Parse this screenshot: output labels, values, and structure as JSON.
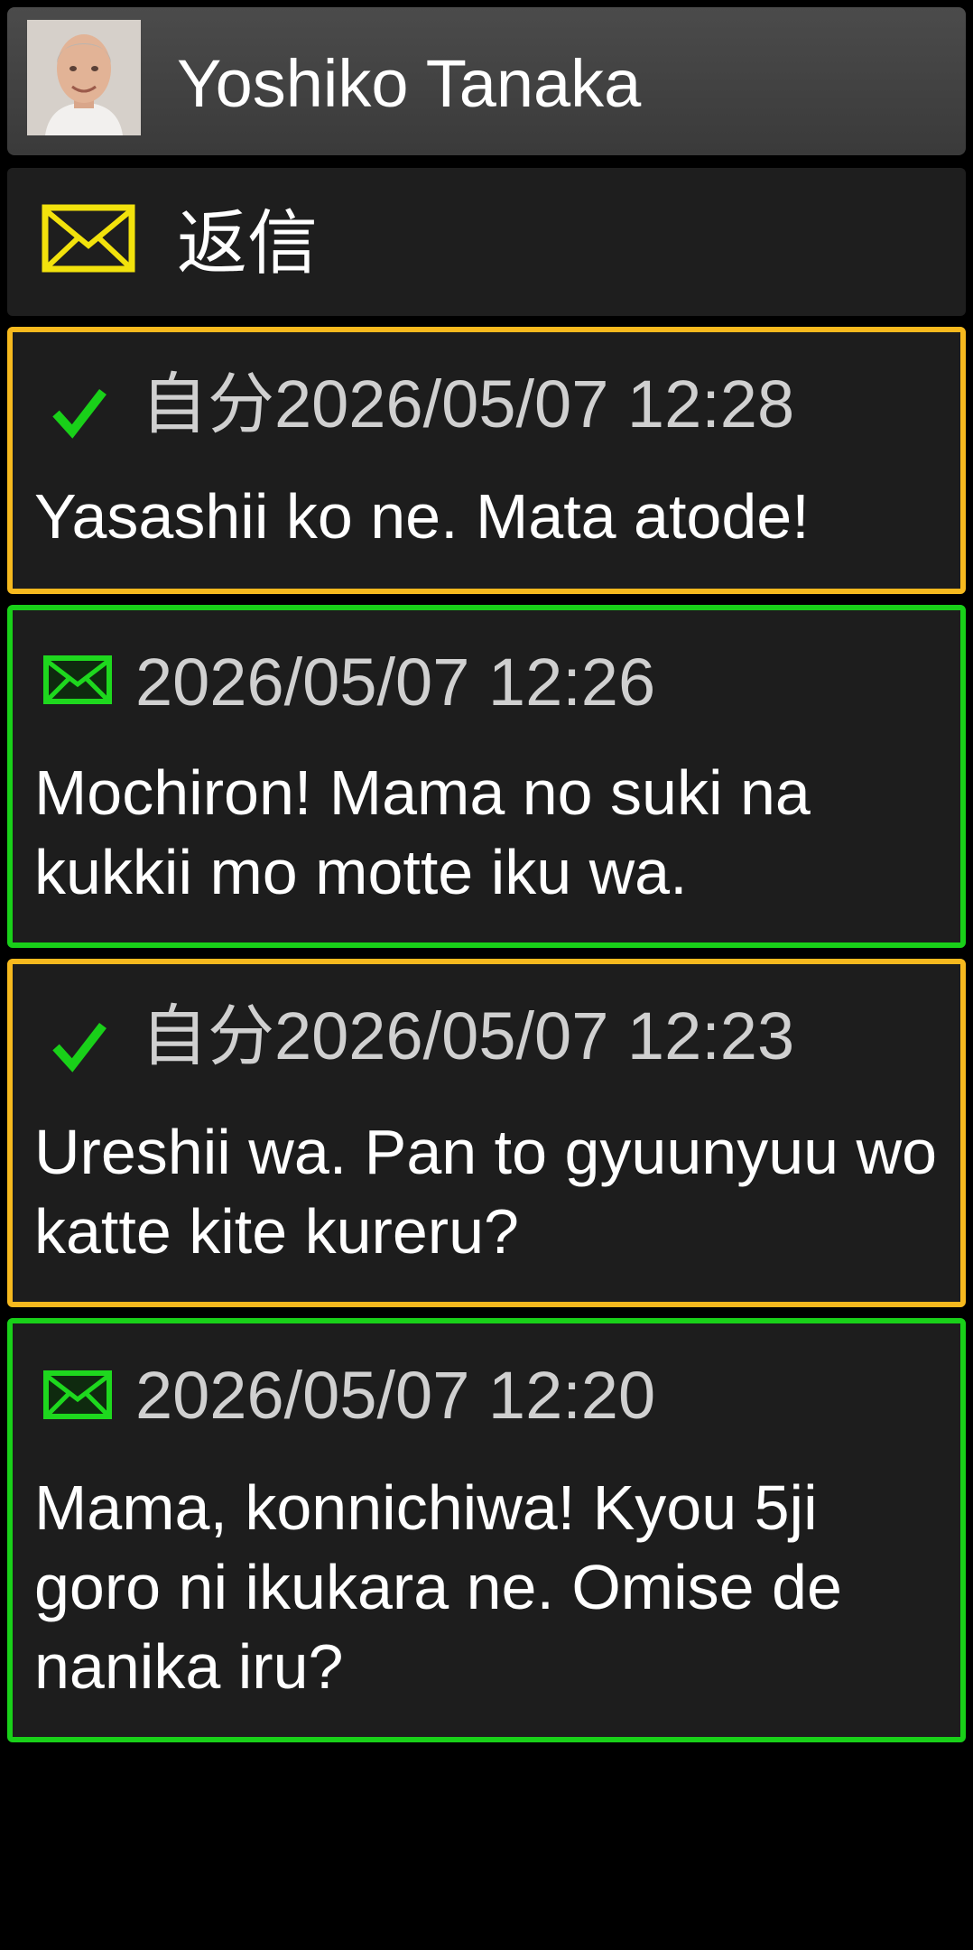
{
  "header": {
    "contact_name": "Yoshiko Tanaka",
    "avatar_icon": "contact-avatar"
  },
  "reply": {
    "label": "返信",
    "icon": "envelope-icon",
    "icon_color": "#f2e20c"
  },
  "colors": {
    "sent_border": "#f6b91e",
    "received_border": "#19d019",
    "sent_check": "#19d019",
    "received_envelope": "#1ed81e"
  },
  "messages": [
    {
      "direction": "sent",
      "icon": "check-icon",
      "time": "自分2026/05/07 12:28",
      "text": "Yasashii ko ne. Mata atode!"
    },
    {
      "direction": "received",
      "icon": "envelope-icon",
      "time": "2026/05/07 12:26",
      "text": "Mochiron! Mama no suki na kukkii mo motte iku wa."
    },
    {
      "direction": "sent",
      "icon": "check-icon",
      "time": "自分2026/05/07 12:23",
      "text": "Ureshii wa. Pan to gyuunyuu wo katte kite kureru?"
    },
    {
      "direction": "received",
      "icon": "envelope-icon",
      "time": "2026/05/07 12:20",
      "text": "Mama, konnichiwa! Kyou 5ji goro ni ikukara ne. Omise de nanika iru?"
    }
  ]
}
